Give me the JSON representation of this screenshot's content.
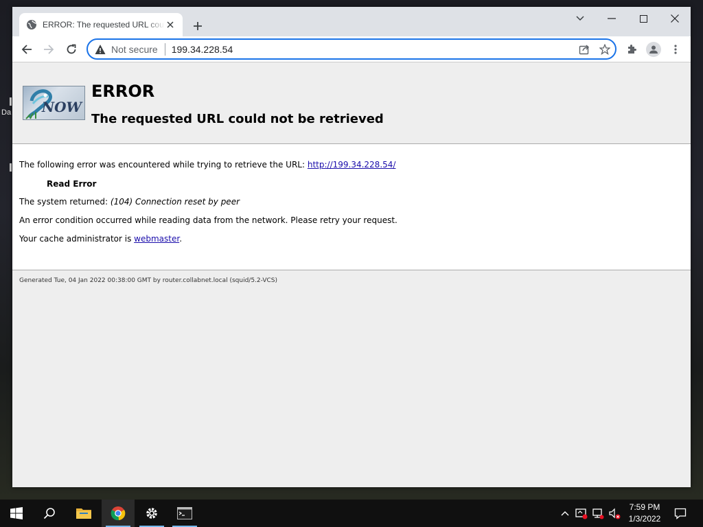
{
  "desktop": {
    "label": "Da"
  },
  "tab": {
    "title": "ERROR: The requested URL could not be retrieved"
  },
  "omnibox": {
    "security_label": "Not secure",
    "url": "199.34.228.54"
  },
  "page": {
    "heading": "ERROR",
    "subheading": "The requested URL could not be retrieved",
    "intro_text": "The following error was encountered while trying to retrieve the URL: ",
    "error_url": "http://199.34.228.54/",
    "error_name": "Read Error",
    "system_returned_label": "The system returned: ",
    "system_returned_value": "(104) Connection reset by peer",
    "condition_text": "An error condition occurred while reading data from the network. Please retry your request.",
    "admin_text": "Your cache administrator is ",
    "admin_link": "webmaster",
    "admin_suffix": ".",
    "footer": "Generated Tue, 04 Jan 2022 00:38:00 GMT by router.collabnet.local (squid/5.2-VCS)",
    "logo_text": "NOW"
  },
  "taskbar": {
    "clock_time": "7:59 PM",
    "clock_date": "1/3/2022"
  },
  "colors": {
    "accent": "#1a73e8",
    "taskbar": "#101010",
    "link": "#1a0dab"
  }
}
